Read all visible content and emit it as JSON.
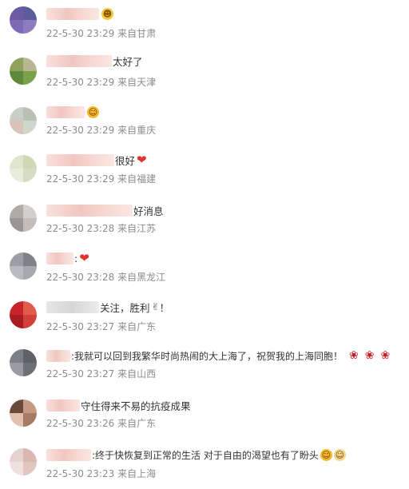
{
  "comments": [
    {
      "text": "",
      "emoji": "laugh-emoji",
      "time": "22-5-30 23:29",
      "location": "来自甘肃"
    },
    {
      "text": "太好了",
      "time": "22-5-30 23:29",
      "location": "来自天津"
    },
    {
      "text": "",
      "emoji": "wow-emoji",
      "time": "22-5-30 23:29",
      "location": "来自重庆"
    },
    {
      "text": "很好",
      "emoji": "heart-emoji",
      "time": "22-5-30 23:29",
      "location": "来自福建"
    },
    {
      "text": "好消息",
      "time": "22-5-30 23:28",
      "location": "来自江苏"
    },
    {
      "text": ":",
      "emoji": "heart-emoji",
      "time": "22-5-30 23:28",
      "location": "来自黑龙江"
    },
    {
      "text": "关注，胜利",
      "emoji": "victory-emoji",
      "suffix": "！",
      "time": "22-5-30 23:27",
      "location": "来自广东"
    },
    {
      "text": ":我就可以回到我繁华时尚热闹的大上海了，祝贺我的上海同胞！",
      "emoji": "rose-emoji",
      "time": "22-5-30 23:27",
      "location": "来自山西"
    },
    {
      "text": "守住得来不易的抗疫成果",
      "time": "22-5-30 23:26",
      "location": "来自广东"
    },
    {
      "text": ":终于快恢复到正常的生活 对于自由的渴望也有了盼头",
      "emoji": "cat-emoji",
      "time": "22-5-30 23:23",
      "location": "来自上海"
    }
  ],
  "colors": {
    "meta_text": "#8c8c8c",
    "body_text": "#333333",
    "heart": "#e0322d"
  }
}
